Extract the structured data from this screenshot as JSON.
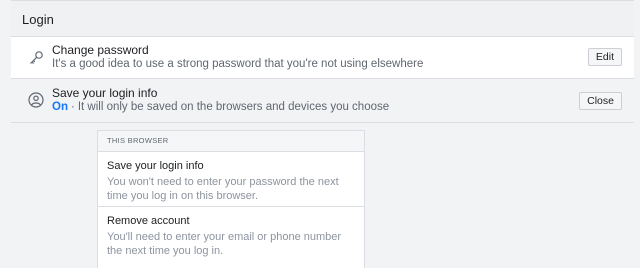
{
  "section": {
    "title": "Login"
  },
  "change_password": {
    "label": "Change password",
    "description": "It's a good idea to use a strong password that you're not using elsewhere",
    "button": "Edit"
  },
  "save_login": {
    "label": "Save your login info",
    "status": "On",
    "separator": "·",
    "description": "It will only be saved on the browsers and devices you choose",
    "button": "Close"
  },
  "this_browser": {
    "header": "THIS BROWSER",
    "items": [
      {
        "title": "Save your login info",
        "description": "You won't need to enter your password the next time you log in on this browser."
      },
      {
        "title": "Remove account",
        "description": "You'll need to enter your email or phone number the next time you log in."
      }
    ]
  },
  "icons": {
    "change_password": "key-icon",
    "save_login": "user-circle-icon"
  }
}
